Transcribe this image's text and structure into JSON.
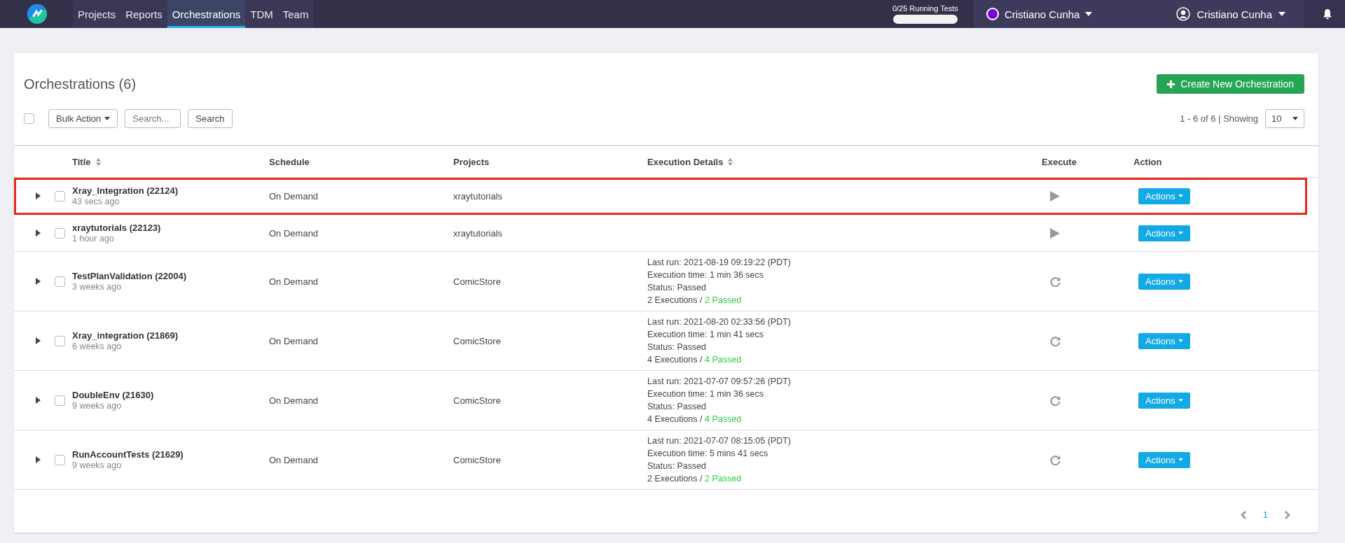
{
  "nav": {
    "items": [
      {
        "label": "Projects",
        "selected": false
      },
      {
        "label": "Reports",
        "selected": false
      },
      {
        "label": "Orchestrations",
        "selected": true
      },
      {
        "label": "TDM",
        "selected": false
      },
      {
        "label": "Team",
        "selected": false
      }
    ],
    "running_tests": {
      "label": "0/25 Running Tests",
      "level": 0
    },
    "workspace": {
      "name": "Cristiano Cunha",
      "color": "#7a00d9"
    },
    "user": {
      "name": "Cristiano Cunha"
    }
  },
  "page": {
    "title": "Orchestrations (6)",
    "create_button": "Create New Orchestration",
    "select_all": {
      "checked": false
    },
    "bulk_action": "Bulk Action",
    "search": {
      "placeholder": "Search..."
    },
    "search_button": "Search",
    "range": "1 - 6 of 6 | Showing",
    "page_size": "10"
  },
  "table": {
    "columns": [
      {
        "label": "Title",
        "sortable": true
      },
      {
        "label": "Schedule",
        "sortable": false
      },
      {
        "label": "Projects",
        "sortable": false
      },
      {
        "label": "Execution Details",
        "sortable": true
      },
      {
        "label": "Execute",
        "sortable": false
      },
      {
        "label": "Action",
        "sortable": false
      }
    ],
    "rows": [
      {
        "title": "Xray_Integration (22124)",
        "ago": "43 secs ago",
        "schedule": "On Demand",
        "project": "xraytutorials",
        "kind": "play",
        "action": "Actions",
        "highlighted": true,
        "checked": false
      },
      {
        "title": "xraytutorials (22123)",
        "ago": "1 hour ago",
        "schedule": "On Demand",
        "project": "xraytutorials",
        "kind": "play",
        "action": "Actions",
        "highlighted": false,
        "checked": false
      },
      {
        "title": "TestPlanValidation (22004)",
        "ago": "3 weeks ago",
        "schedule": "On Demand",
        "project": "ComicStore",
        "kind": "rerun",
        "action": "Actions",
        "highlighted": false,
        "checked": false,
        "details": {
          "last_run": "Last run: 2021-08-19 09:19:22 (PDT)",
          "execution_time": "Execution time: 1 min 36 secs",
          "status": "Status: Passed",
          "executions": "2 Executions /",
          "passed": "2 Passed"
        }
      },
      {
        "title": "Xray_integration (21869)",
        "ago": "6 weeks ago",
        "schedule": "On Demand",
        "project": "ComicStore",
        "kind": "rerun",
        "action": "Actions",
        "highlighted": false,
        "checked": false,
        "details": {
          "last_run": "Last run: 2021-08-20 02:33:56 (PDT)",
          "execution_time": "Execution time: 1 min 41 secs",
          "status": "Status: Passed",
          "executions": "4 Executions /",
          "passed": "4 Passed"
        }
      },
      {
        "title": "DoubleEnv (21630)",
        "ago": "9 weeks ago",
        "schedule": "On Demand",
        "project": "ComicStore",
        "kind": "rerun",
        "action": "Actions",
        "highlighted": false,
        "checked": false,
        "details": {
          "last_run": "Last run: 2021-07-07 09:57:26 (PDT)",
          "execution_time": "Execution time: 1 min 36 secs",
          "status": "Status: Passed",
          "executions": "4 Executions /",
          "passed": "4 Passed"
        }
      },
      {
        "title": "RunAccountTests (21629)",
        "ago": "9 weeks ago",
        "schedule": "On Demand",
        "project": "ComicStore",
        "kind": "rerun",
        "action": "Actions",
        "highlighted": false,
        "checked": false,
        "details": {
          "last_run": "Last run: 2021-07-07 08:15:05 (PDT)",
          "execution_time": "Execution time: 5 mins 41 secs",
          "status": "Status: Passed",
          "executions": "2 Executions /",
          "passed": "2 Passed"
        }
      }
    ]
  },
  "pagination": {
    "pages": [
      {
        "label": "1",
        "selected": true
      }
    ]
  }
}
